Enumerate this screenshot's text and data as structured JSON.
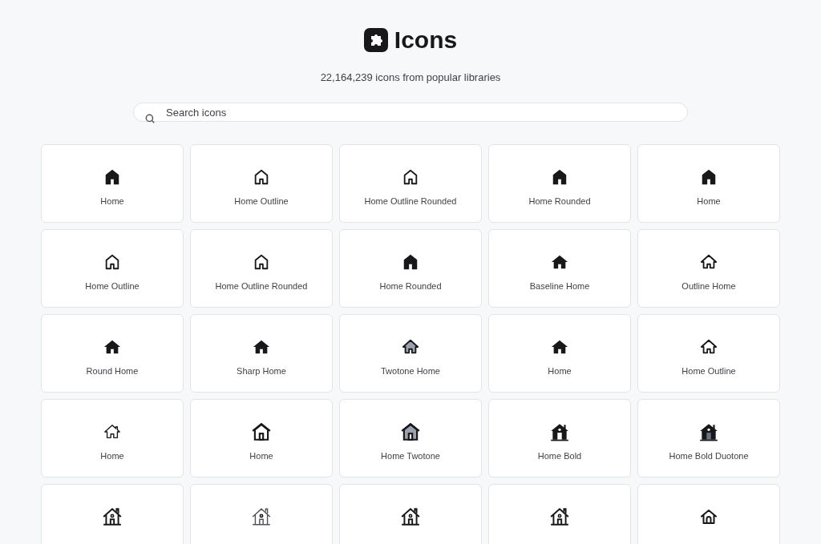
{
  "header": {
    "title": "Icons",
    "subtitle": "22,164,239 icons from popular libraries"
  },
  "search": {
    "placeholder": "Search icons"
  },
  "icons": [
    {
      "label": "Home",
      "kind": "solid"
    },
    {
      "label": "Home Outline",
      "kind": "outline"
    },
    {
      "label": "Home Outline Rounded",
      "kind": "outline"
    },
    {
      "label": "Home Rounded",
      "kind": "solid"
    },
    {
      "label": "Home",
      "kind": "solid"
    },
    {
      "label": "Home Outline",
      "kind": "outline"
    },
    {
      "label": "Home Outline Rounded",
      "kind": "outline"
    },
    {
      "label": "Home Rounded",
      "kind": "solid"
    },
    {
      "label": "Baseline Home",
      "kind": "eaves"
    },
    {
      "label": "Outline Home",
      "kind": "eaves-outline"
    },
    {
      "label": "Round Home",
      "kind": "eaves"
    },
    {
      "label": "Sharp Home",
      "kind": "eaves"
    },
    {
      "label": "Twotone Home",
      "kind": "eaves-twotone"
    },
    {
      "label": "Home",
      "kind": "eaves"
    },
    {
      "label": "Home Outline",
      "kind": "eaves-outline"
    },
    {
      "label": "Home",
      "kind": "chimney-outline"
    },
    {
      "label": "Home",
      "kind": "door-outline"
    },
    {
      "label": "Home Twotone",
      "kind": "door-twotone"
    },
    {
      "label": "Home Bold",
      "kind": "cottage-bold"
    },
    {
      "label": "Home Bold Duotone",
      "kind": "cottage-duotone"
    },
    {
      "kind": "cottage"
    },
    {
      "kind": "cottage-light"
    },
    {
      "kind": "cottage"
    },
    {
      "kind": "cottage"
    },
    {
      "kind": "round-outline"
    }
  ]
}
